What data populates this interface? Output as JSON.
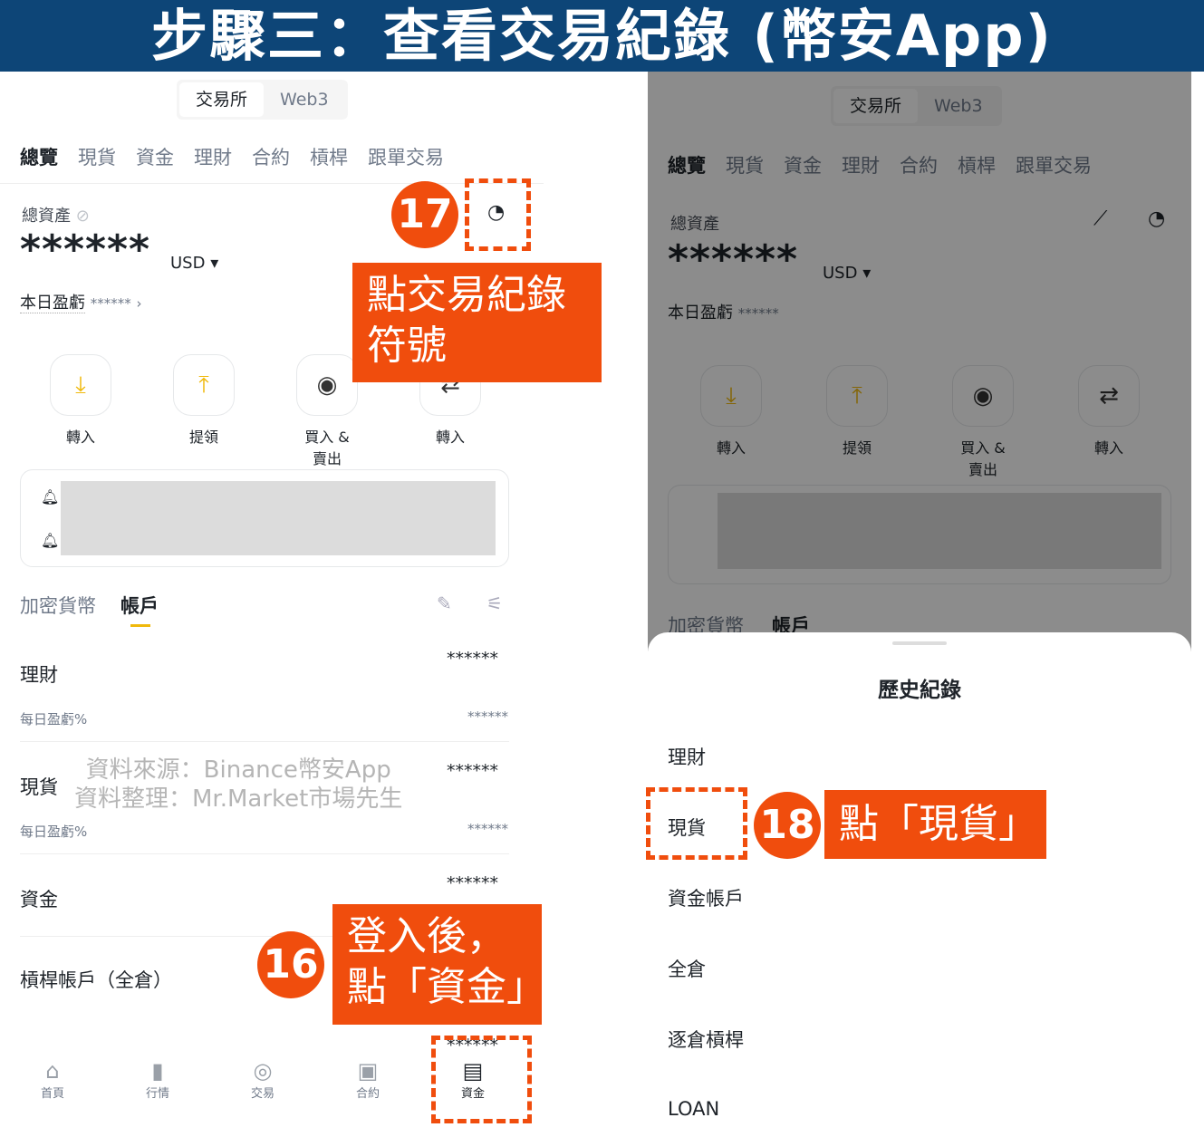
{
  "banner": {
    "title": "步驟三：查看交易紀錄 (幣安App)"
  },
  "segment": {
    "exchange": "交易所",
    "web3": "Web3"
  },
  "tabs": [
    "總覽",
    "現貨",
    "資金",
    "理財",
    "合約",
    "槓桿",
    "跟單交易"
  ],
  "overview": {
    "total_label": "總資產",
    "balance": "******",
    "currency": "USD",
    "pnl_label": "本日盈虧",
    "pnl_value": "******"
  },
  "actions": [
    {
      "label": "轉入",
      "icon": "deposit-icon"
    },
    {
      "label": "提領",
      "icon": "withdraw-icon"
    },
    {
      "label": "買入 & 賣出",
      "icon": "buy-sell-icon"
    },
    {
      "label": "轉入",
      "icon": "transfer-icon"
    }
  ],
  "list_tabs": {
    "crypto": "加密貨幣",
    "account": "帳戶"
  },
  "accounts": [
    {
      "name": "理財",
      "value": "******",
      "sub": "每日盈虧%",
      "sub_value": "******"
    },
    {
      "name": "現貨",
      "value": "******",
      "sub": "每日盈虧%",
      "sub_value": "******"
    },
    {
      "name": "資金",
      "value": "******"
    },
    {
      "name": "槓桿帳戶（全倉）",
      "value": "******"
    }
  ],
  "bottom_nav": [
    "首頁",
    "行情",
    "交易",
    "合約",
    "資金"
  ],
  "watermark": {
    "line1": "資料來源：Binance幣安App",
    "line2": "資料整理：Mr.Market市場先生"
  },
  "annotations": {
    "step16_num": "16",
    "step16_text1": "登入後，",
    "step16_text2": "點「資金」",
    "step17_num": "17",
    "step17_text1": "點交易紀錄",
    "step17_text2": "符號",
    "step18_num": "18",
    "step18_text": "點「現貨」"
  },
  "history_sheet": {
    "title": "歷史紀錄",
    "items": [
      "理財",
      "現貨",
      "資金帳戶",
      "全倉",
      "逐倉槓桿",
      "LOAN"
    ]
  },
  "colors": {
    "accent": "#f04d0d",
    "banner": "#0d4577",
    "brand": "#f0b90b"
  }
}
